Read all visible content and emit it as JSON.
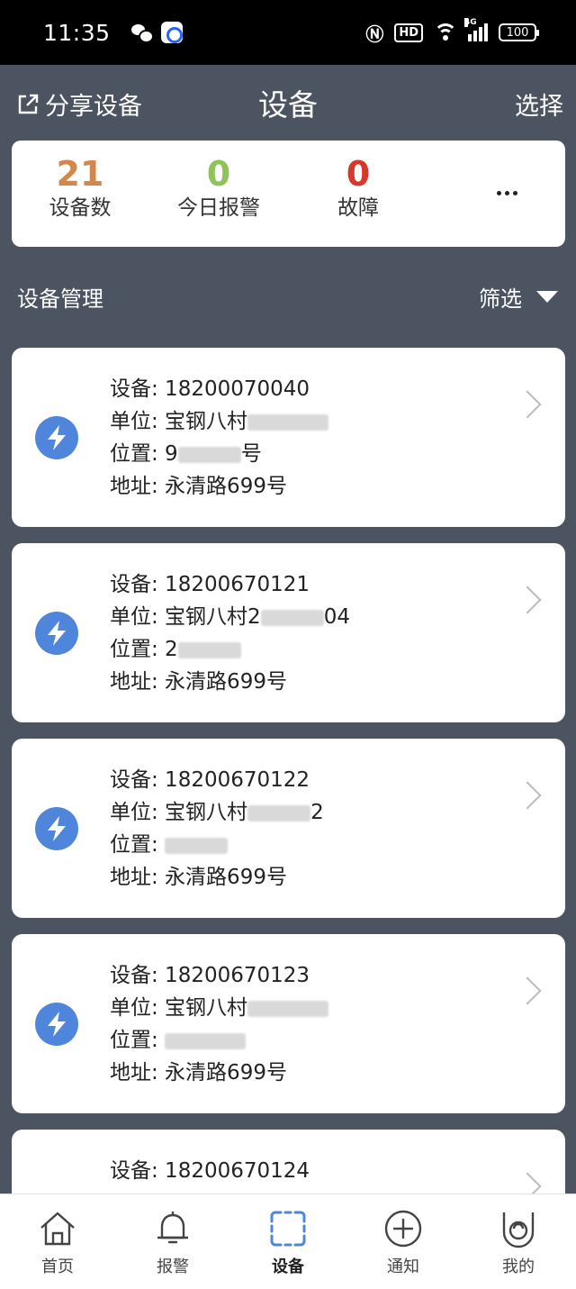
{
  "status_bar": {
    "time": "11:35",
    "hd_badge": "HD",
    "network": "4G",
    "battery": "100"
  },
  "header": {
    "share_label": "分享设备",
    "title": "设备",
    "select_label": "选择"
  },
  "summary": {
    "stats": [
      {
        "value": "21",
        "label": "设备数",
        "color": "#d4874c"
      },
      {
        "value": "0",
        "label": "今日报警",
        "color": "#8fc35a"
      },
      {
        "value": "0",
        "label": "故障",
        "color": "#d8382b"
      }
    ],
    "more_icon": "ellipsis-icon"
  },
  "section": {
    "title": "设备管理",
    "filter_label": "筛选"
  },
  "devices": [
    {
      "device": "设备: 18200070040",
      "unit": "单位: 宝钢八村",
      "location": "位置: 9",
      "location_suffix": "号",
      "address": "地址: 永清路699号"
    },
    {
      "device": "设备: 18200670121",
      "unit": "单位: 宝钢八村2",
      "unit_suffix": "04",
      "location": "位置: 2",
      "address": "地址: 永清路699号"
    },
    {
      "device": "设备: 18200670122",
      "unit": "单位: 宝钢八村",
      "unit_suffix": "2",
      "location": "位置: ",
      "address": "地址: 永清路699号"
    },
    {
      "device": "设备: 18200670123",
      "unit": "单位: 宝钢八村",
      "location": "位置: ",
      "address": "地址: 永清路699号"
    },
    {
      "device": "设备: 18200670124"
    }
  ],
  "tabs": [
    {
      "label": "首页",
      "icon": "home-icon"
    },
    {
      "label": "报警",
      "icon": "bell-icon"
    },
    {
      "label": "设备",
      "icon": "scan-frame-icon",
      "active": true
    },
    {
      "label": "通知",
      "icon": "plus-circle-icon"
    },
    {
      "label": "我的",
      "icon": "profile-icon"
    }
  ],
  "colors": {
    "background": "#4c5462",
    "device_icon": "#4f86db",
    "active_tab": "#4f86db"
  }
}
